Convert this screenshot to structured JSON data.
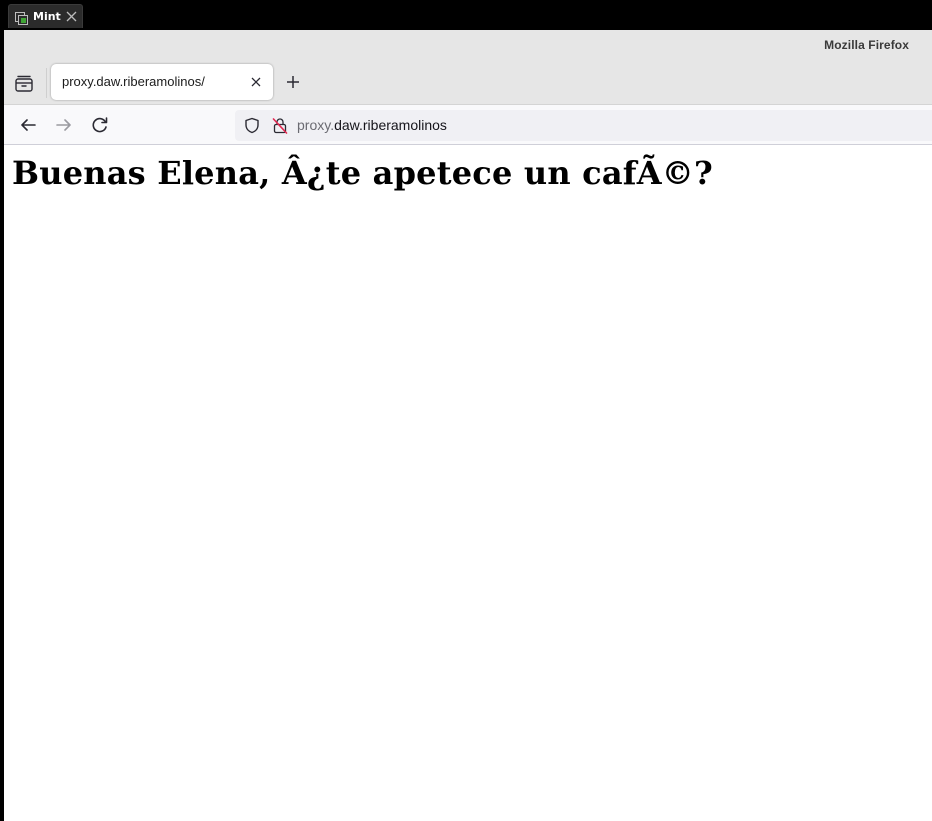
{
  "vm": {
    "tab_label": "Mint",
    "tab_icon": "vm-display-icon",
    "close_icon": "close-icon"
  },
  "window": {
    "title": "Mozilla Firefox"
  },
  "tabs": [
    {
      "title": "proxy.daw.riberamolinos/",
      "active": true
    }
  ],
  "navbar": {
    "back_icon": "arrow-left-icon",
    "forward_icon": "arrow-right-icon",
    "reload_icon": "reload-icon",
    "url_subdomain": "proxy.",
    "url_domain": "daw.riberamolinos",
    "security_icons": [
      "shield-icon",
      "insecure-lock-icon"
    ]
  },
  "page": {
    "heading": "Buenas Elena, Â¿te apetece un cafÃ©?"
  },
  "colors": {
    "accent_vm": "#3fa535",
    "toolbar_bg": "#e6e6e6",
    "urlbar_bg": "#f0f0f4",
    "insecure_red": "#e22850"
  }
}
